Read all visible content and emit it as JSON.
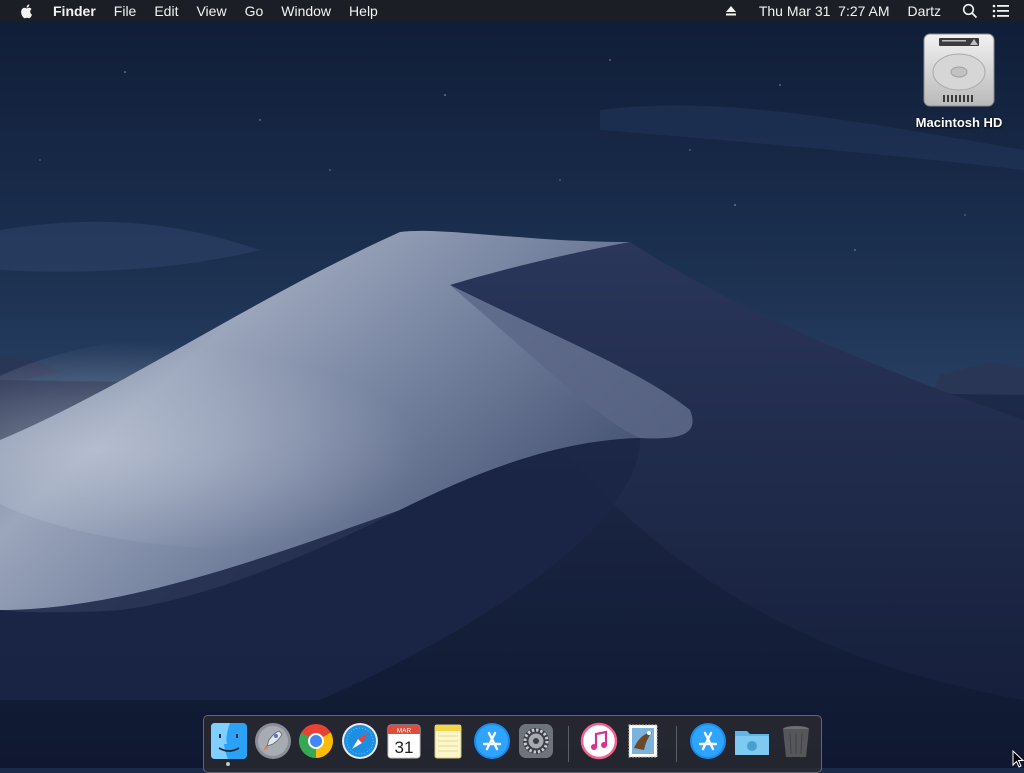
{
  "menubar": {
    "app_name": "Finder",
    "menus": [
      "File",
      "Edit",
      "View",
      "Go",
      "Window",
      "Help"
    ],
    "clock": "Thu Mar 31  7:27 AM",
    "user": "Dartz"
  },
  "desktop": {
    "icons": [
      {
        "label": "Macintosh HD",
        "icon": "hard-drive-icon"
      }
    ]
  },
  "dock": {
    "apps": [
      {
        "name": "finder",
        "icon": "finder-icon",
        "running": true
      },
      {
        "name": "launchpad",
        "icon": "rocket-icon",
        "running": false
      },
      {
        "name": "chrome",
        "icon": "chrome-icon",
        "running": false
      },
      {
        "name": "safari",
        "icon": "compass-icon",
        "running": false
      },
      {
        "name": "calendar",
        "icon": "calendar-icon",
        "running": false,
        "month": "MAR",
        "day": "31"
      },
      {
        "name": "notes",
        "icon": "notepad-icon",
        "running": false
      },
      {
        "name": "app-store",
        "icon": "app-store-icon",
        "running": false
      },
      {
        "name": "system-preferences",
        "icon": "gear-icon",
        "running": false
      },
      {
        "name": "itunes",
        "icon": "music-note-icon",
        "running": false
      },
      {
        "name": "mail",
        "icon": "eagle-stamp-icon",
        "running": false
      },
      {
        "name": "applications-folder",
        "icon": "app-store-icon",
        "running": false
      },
      {
        "name": "downloads-folder",
        "icon": "folder-icon",
        "running": false
      },
      {
        "name": "trash",
        "icon": "trash-icon",
        "running": false
      }
    ]
  },
  "colors": {
    "sky_top": "#0f1c36",
    "sky_mid": "#243a5e",
    "dune_light": "#a7b2c6",
    "dune_dark": "#1a2542"
  }
}
